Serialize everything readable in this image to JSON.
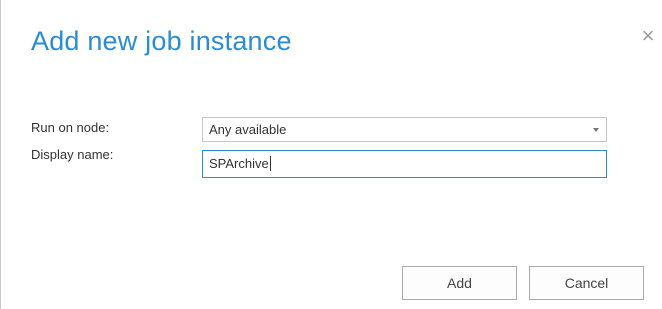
{
  "dialog": {
    "title": "Add new job instance",
    "close_glyph": "×",
    "close_icon": "close-icon"
  },
  "form": {
    "run_on_node": {
      "label": "Run on node:",
      "value": "Any available",
      "arrow_icon": "chevron-down-icon"
    },
    "display_name": {
      "label": "Display name:",
      "value": "SPArchive"
    }
  },
  "buttons": {
    "add_label": "Add",
    "cancel_label": "Cancel"
  },
  "colors": {
    "accent": "#2a8dd4",
    "text": "#333333",
    "border": "#c6c6c6"
  }
}
